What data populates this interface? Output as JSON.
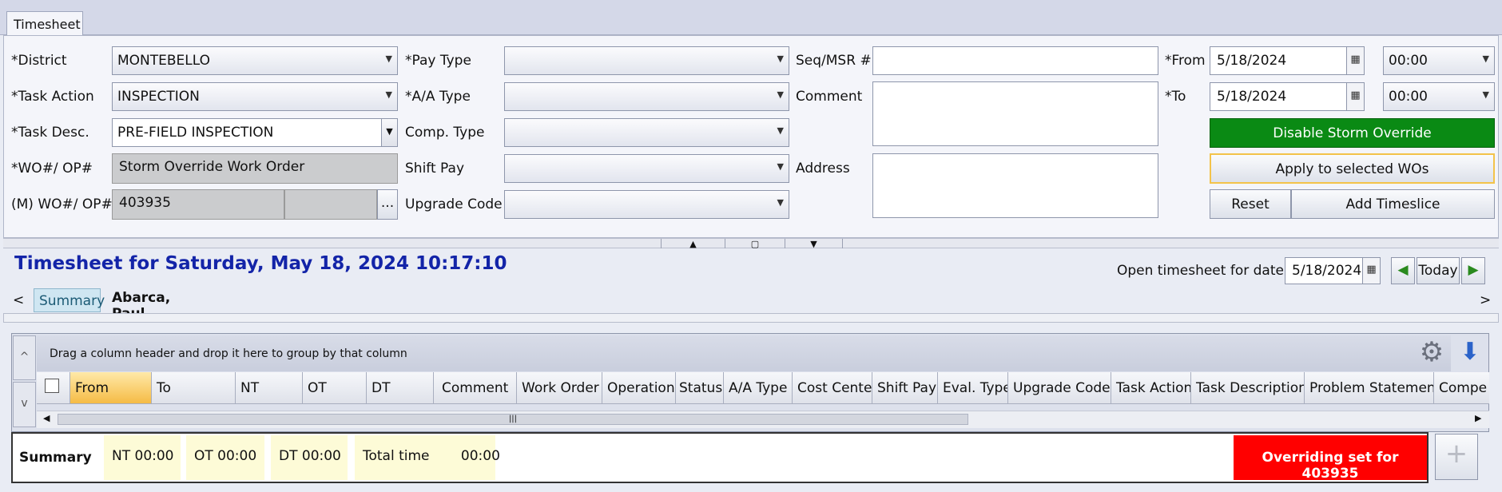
{
  "tab": "Timesheet",
  "form": {
    "district": {
      "label": "*District",
      "value": "MONTEBELLO"
    },
    "task_action": {
      "label": "*Task Action",
      "value": "INSPECTION"
    },
    "task_desc": {
      "label": "*Task Desc.",
      "value": "PRE-FIELD INSPECTION"
    },
    "wo_op": {
      "label": "*WO#/ OP#",
      "value": "Storm Override Work Order"
    },
    "m_wo_op": {
      "label": "(M) WO#/ OP#",
      "value": "403935",
      "ellipsis": "..."
    },
    "pay_type": {
      "label": "*Pay Type",
      "value": ""
    },
    "aa_type": {
      "label": "*A/A Type",
      "value": ""
    },
    "comp_type": {
      "label": "Comp. Type",
      "value": ""
    },
    "shift_pay": {
      "label": "Shift Pay",
      "value": ""
    },
    "upgrade_code": {
      "label": "Upgrade Code",
      "value": ""
    },
    "seq_msr": {
      "label": "Seq/MSR #",
      "value": ""
    },
    "comment": {
      "label": "Comment",
      "value": ""
    },
    "address": {
      "label": "Address",
      "value": ""
    },
    "from": {
      "label": "*From",
      "date": "5/18/2024",
      "time": "00:00"
    },
    "to": {
      "label": "*To",
      "date": "5/18/2024",
      "time": "00:00"
    }
  },
  "buttons": {
    "disable_storm": "Disable Storm Override",
    "apply_selected": "Apply to selected WOs",
    "reset": "Reset",
    "add_timeslice": "Add Timeslice",
    "today": "Today"
  },
  "timesheet": {
    "title": "Timesheet for Saturday, May 18, 2024 10:17:10",
    "open_label": "Open timesheet for date:",
    "open_date": "5/18/2024",
    "tabs": [
      "Summary",
      "Abarca, Paul"
    ],
    "nav_left": "<",
    "nav_right": ">"
  },
  "grid": {
    "group_hint": "Drag a column header and drop it here to group by that column",
    "columns": [
      "From",
      "To",
      "NT",
      "OT",
      "DT",
      "Comment",
      "Work Order",
      "Operation",
      "Status",
      "A/A Type",
      "Cost Center",
      "Shift Pay",
      "Eval. Type",
      "Upgrade Code",
      "Task Action",
      "Task Description",
      "Problem Statement",
      "Compe"
    ],
    "side_up": "^",
    "side_down": "v"
  },
  "summary": {
    "label": "Summary",
    "nt": "NT  00:00",
    "ot": "OT  00:00",
    "dt": "DT  00:00",
    "total_label": "Total time",
    "total_value": "00:00",
    "override": "Overriding set for 403935"
  },
  "colors": {
    "accent_title": "#1324a8",
    "green": "#0a8a14",
    "override_red": "#ff0000"
  }
}
